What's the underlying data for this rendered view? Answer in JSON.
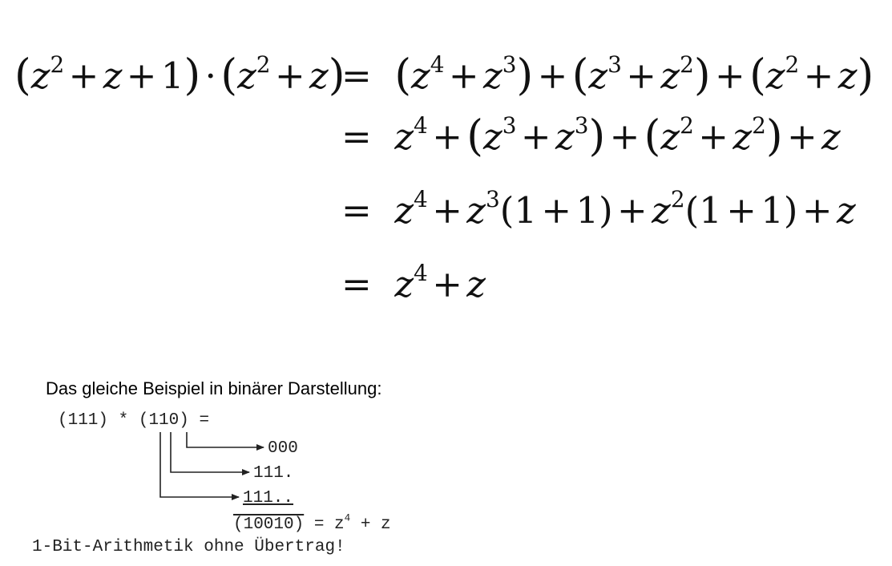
{
  "derivation": {
    "lhs": "(z² + z + 1) · (z² + z)",
    "steps": [
      "= (z⁴ + z³) + (z³ + z²) + (z² + z)",
      "= z⁴ + (z³ + z³) + (z² + z²) + z",
      "= z⁴ + z³ (1 + 1) + z² (1 + 1) + z",
      "= z⁴ + z"
    ]
  },
  "binary_example": {
    "heading": "Das gleiche Beispiel in binärer Darstellung:",
    "factor_a": "(111)",
    "times": "*",
    "factor_b": "(110)",
    "equals": "=",
    "partial_products": [
      "000",
      "111.",
      "111.."
    ],
    "result_binary": "(10010)",
    "result_tail": "= z",
    "result_exponent": "4",
    "result_rest": "+ z",
    "note": "1-Bit-Arithmetik ohne Übertrag!"
  }
}
